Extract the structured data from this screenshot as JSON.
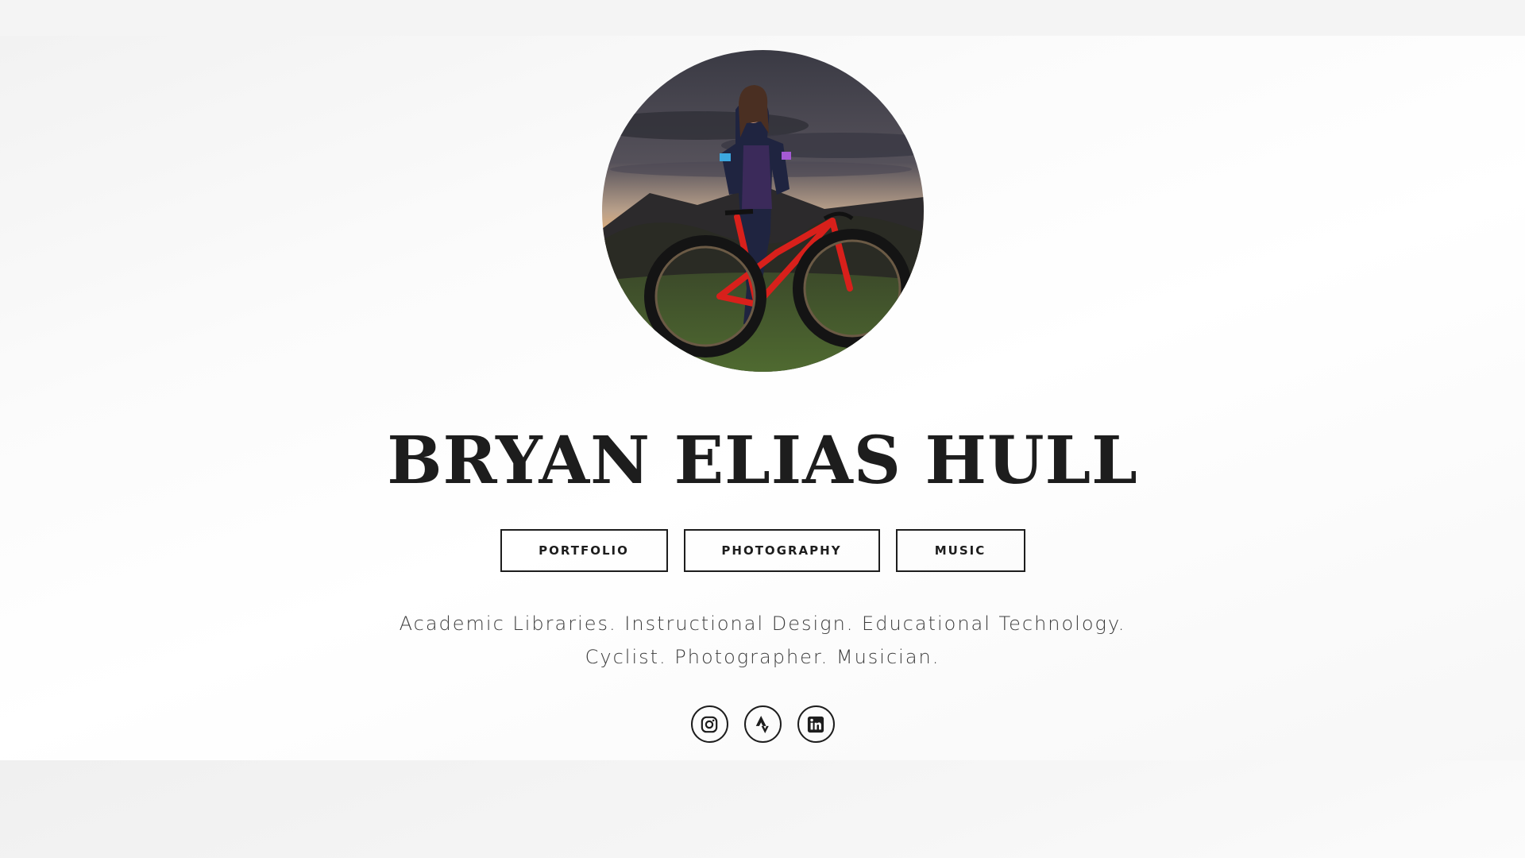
{
  "profile": {
    "name_first": "BRYAN",
    "name_rest": " ELIAS HULL",
    "photo_alt": "avatar-photo"
  },
  "nav": {
    "items": [
      {
        "label": "PORTFOLIO"
      },
      {
        "label": "PHOTOGRAPHY"
      },
      {
        "label": "MUSIC"
      }
    ]
  },
  "tagline": {
    "line1": "Academic Libraries. Instructional Design. Educational Technology.",
    "line2": "Cyclist. Photographer. Musician."
  },
  "social": {
    "icons": [
      "instagram-icon",
      "strava-icon",
      "linkedin-icon"
    ]
  },
  "colors": {
    "text": "#1d1d1d",
    "underline_start": "#d61ee3",
    "underline_end": "#3f9fe6"
  }
}
